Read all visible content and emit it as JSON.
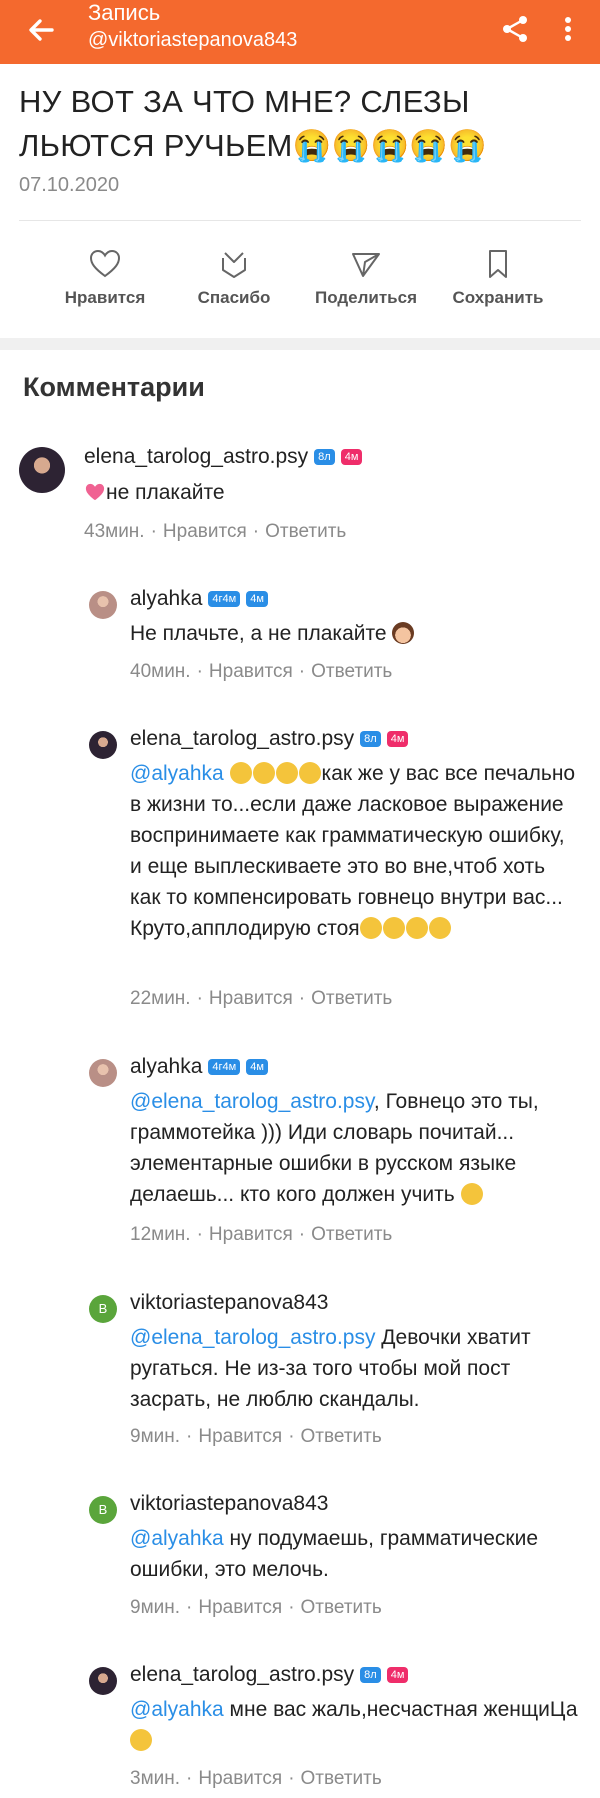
{
  "header": {
    "title": "Запись",
    "subtitle": "@viktoriastepanova843"
  },
  "post": {
    "title_text": "НУ ВОТ ЗА ЧТО МНЕ? СЛЕЗЫ ЛЬЮТСЯ РУЧЬЕМ",
    "title_emoji": "😭😭😭😭😭",
    "date": "07.10.2020"
  },
  "actions": [
    {
      "label": "Нравится",
      "icon": "heart-icon"
    },
    {
      "label": "Спасибо",
      "icon": "thanks-icon"
    },
    {
      "label": "Поделиться",
      "icon": "send-icon"
    },
    {
      "label": "Сохранить",
      "icon": "bookmark-icon"
    }
  ],
  "comments_heading": "Комментарии",
  "common": {
    "like": "Нравится",
    "reply": "Ответить",
    "dot": "·"
  },
  "comments": [
    {
      "user": "elena_tarolog_astro.psy",
      "badge1": "8л",
      "badge2": "4м",
      "text": "не плакайте",
      "time": "43мин."
    },
    {
      "user": "alyahka",
      "badge1": "4г4м",
      "badge2": "4м",
      "text": "Не плачьте, а не плакайте",
      "time": "40мин."
    },
    {
      "user": "elena_tarolog_astro.psy",
      "badge1": "8л",
      "badge2": "4м",
      "mention": "@alyahka",
      "text": "как же у вас все печально в жизни то...если даже ласковое выражение воспринимаете как грамматическую ошибку, и еще выплескиваете это во вне,чтоб хоть как то компенсировать говнецо внутри вас... Круто,апплодирую стоя",
      "time": "22мин."
    },
    {
      "user": "alyahka",
      "badge1": "4г4м",
      "badge2": "4м",
      "mention": "@elena_tarolog_astro.psy",
      "text": ", Говнецо это ты, граммотейка ))) Иди словарь почитай... элементарные ошибки в русском языке делаешь... кто кого должен учить",
      "time": "12мин."
    },
    {
      "user": "viktoriastepanova843",
      "avatar_letter": "В",
      "mention": "@elena_tarolog_astro.psy",
      "text": " Девочки  хватит ругаться. Не из-за того чтобы мой пост засрать, не люблю скандалы.",
      "time": "9мин."
    },
    {
      "user": "viktoriastepanova843",
      "avatar_letter": "В",
      "mention": "@alyahka",
      "text": " ну подумаешь, грамматические ошибки, это мелочь.",
      "time": "9мин."
    },
    {
      "user": "elena_tarolog_astro.psy",
      "badge1": "8л",
      "badge2": "4м",
      "mention": "@alyahka",
      "text": " мне вас жаль,несчастная женщиЦа",
      "time": "3мин."
    }
  ],
  "colors": {
    "accent": "#f4692e",
    "link": "#2a8ee6",
    "badge_blue": "#2a8ee6",
    "badge_pink": "#ef2d6a"
  }
}
